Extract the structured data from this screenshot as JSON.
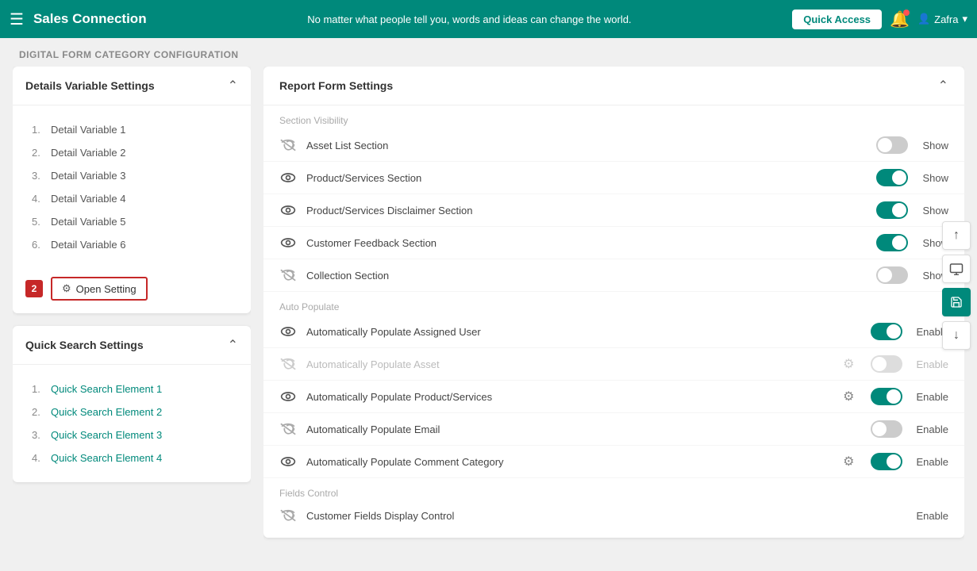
{
  "topnav": {
    "title": "Sales Connection",
    "tagline": "No matter what people tell you, words and ideas can change the world.",
    "quick_access_label": "Quick Access",
    "user_name": "Zafra"
  },
  "page": {
    "header": "Digital Form Category Configuration"
  },
  "details_panel": {
    "title": "Details Variable Settings",
    "items": [
      {
        "num": "1.",
        "label": "Detail Variable 1"
      },
      {
        "num": "2.",
        "label": "Detail Variable 2"
      },
      {
        "num": "3.",
        "label": "Detail Variable 3"
      },
      {
        "num": "4.",
        "label": "Detail Variable 4"
      },
      {
        "num": "5.",
        "label": "Detail Variable 5"
      },
      {
        "num": "6.",
        "label": "Detail Variable 6"
      }
    ],
    "badge": "2",
    "open_setting_label": "Open Setting"
  },
  "quick_search_panel": {
    "title": "Quick Search Settings",
    "items": [
      {
        "num": "1.",
        "label": "Quick Search Element 1"
      },
      {
        "num": "2.",
        "label": "Quick Search Element 2"
      },
      {
        "num": "3.",
        "label": "Quick Search Element 3"
      },
      {
        "num": "4.",
        "label": "Quick Search Element 4"
      }
    ]
  },
  "report_form_panel": {
    "title": "Report Form Settings",
    "section_visibility_label": "Section Visibility",
    "section_auto_populate_label": "Auto Populate",
    "section_fields_control_label": "Fields Control",
    "rows": [
      {
        "name": "Asset List Section",
        "toggle": "off",
        "label": "Show",
        "icon": "eye-slash",
        "muted": false,
        "gear": false
      },
      {
        "name": "Product/Services Section",
        "toggle": "on",
        "label": "Show",
        "icon": "eye",
        "muted": false,
        "gear": false
      },
      {
        "name": "Product/Services Disclaimer Section",
        "toggle": "on",
        "label": "Show",
        "icon": "eye",
        "muted": false,
        "gear": false
      },
      {
        "name": "Customer Feedback Section",
        "toggle": "on",
        "label": "Show",
        "icon": "eye",
        "muted": false,
        "gear": false
      },
      {
        "name": "Collection Section",
        "toggle": "off",
        "label": "Show",
        "icon": "eye-slash",
        "muted": false,
        "gear": false
      }
    ],
    "auto_rows": [
      {
        "name": "Automatically Populate Assigned User",
        "toggle": "on",
        "label": "Enable",
        "icon": "eye",
        "muted": false,
        "gear": false
      },
      {
        "name": "Automatically Populate Asset",
        "toggle": "muted",
        "label": "Enable",
        "icon": "eye-slash",
        "muted": true,
        "gear": true
      },
      {
        "name": "Automatically Populate Product/Services",
        "toggle": "on",
        "label": "Enable",
        "icon": "eye",
        "muted": false,
        "gear": true
      },
      {
        "name": "Automatically Populate Email",
        "toggle": "off",
        "label": "Enable",
        "icon": "eye-slash",
        "muted": false,
        "gear": false
      },
      {
        "name": "Automatically Populate Comment Category",
        "toggle": "on",
        "label": "Enable",
        "icon": "eye",
        "muted": false,
        "gear": true
      }
    ],
    "fields_rows": [
      {
        "name": "Customer Fields Display Control",
        "toggle": "on",
        "label": "Enable",
        "icon": "eye-slash",
        "muted": false,
        "gear": false
      }
    ]
  }
}
